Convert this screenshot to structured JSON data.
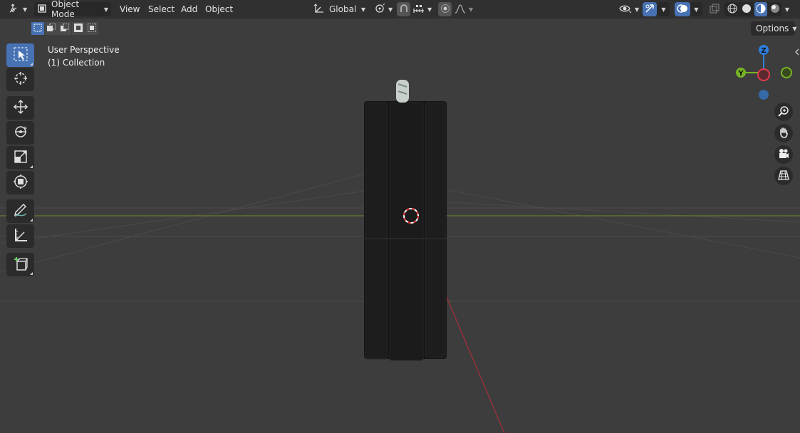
{
  "header": {
    "editor_type_icon": "3d-viewport-icon",
    "mode_label": "Object Mode",
    "menus": [
      "View",
      "Select",
      "Add",
      "Object"
    ],
    "transform_orientation": "Global",
    "icons": [
      "pivot-point-icon",
      "snap-icon",
      "snap-increment-icon",
      "proportional-editing-icon",
      "falloff-icon",
      "visibility-icon",
      "gizmo-icon",
      "overlay-icon",
      "xray-icon",
      "wireframe-shading-icon",
      "solid-shading-icon",
      "material-preview-shading-icon",
      "rendered-shading-icon"
    ]
  },
  "selection_modes": [
    "select-new-icon",
    "select-extend-icon",
    "select-subtract-icon",
    "select-difference-icon",
    "select-intersect-icon"
  ],
  "options_label": "Options",
  "viewport": {
    "perspective_label": "User Perspective",
    "collection_label": "(1) Collection"
  },
  "toolbar": [
    {
      "name": "select-box-tool",
      "icon": "select-box-icon",
      "active": true
    },
    {
      "name": "cursor-tool",
      "icon": "cursor-icon",
      "active": false
    },
    {
      "name": "move-tool",
      "icon": "move-icon",
      "active": false
    },
    {
      "name": "rotate-tool",
      "icon": "rotate-icon",
      "active": false
    },
    {
      "name": "scale-tool",
      "icon": "scale-icon",
      "active": false
    },
    {
      "name": "transform-tool",
      "icon": "transform-icon",
      "active": false
    },
    {
      "name": "annotate-tool",
      "icon": "annotate-icon",
      "active": false
    },
    {
      "name": "measure-tool",
      "icon": "measure-icon",
      "active": false
    },
    {
      "name": "add-cube-tool",
      "icon": "add-cube-icon",
      "active": false
    }
  ],
  "gizmo": {
    "axes": {
      "x": "X",
      "y": "Y",
      "z": "Z"
    },
    "colors": {
      "x": "#e23b4b",
      "y": "#78b526",
      "z": "#2e7fdd",
      "neg_y": "#68922c",
      "neg_z": "#3569a7"
    }
  },
  "nav_buttons": [
    "zoom-icon",
    "pan-hand-icon",
    "camera-view-icon",
    "ortho-grid-icon"
  ],
  "colors": {
    "header_bg": "#303030",
    "viewport_bg": "#3d3d3d",
    "accent": "#4772b3",
    "x_axis_line": "#a0303a",
    "y_axis_line": "#6b8a2c"
  }
}
